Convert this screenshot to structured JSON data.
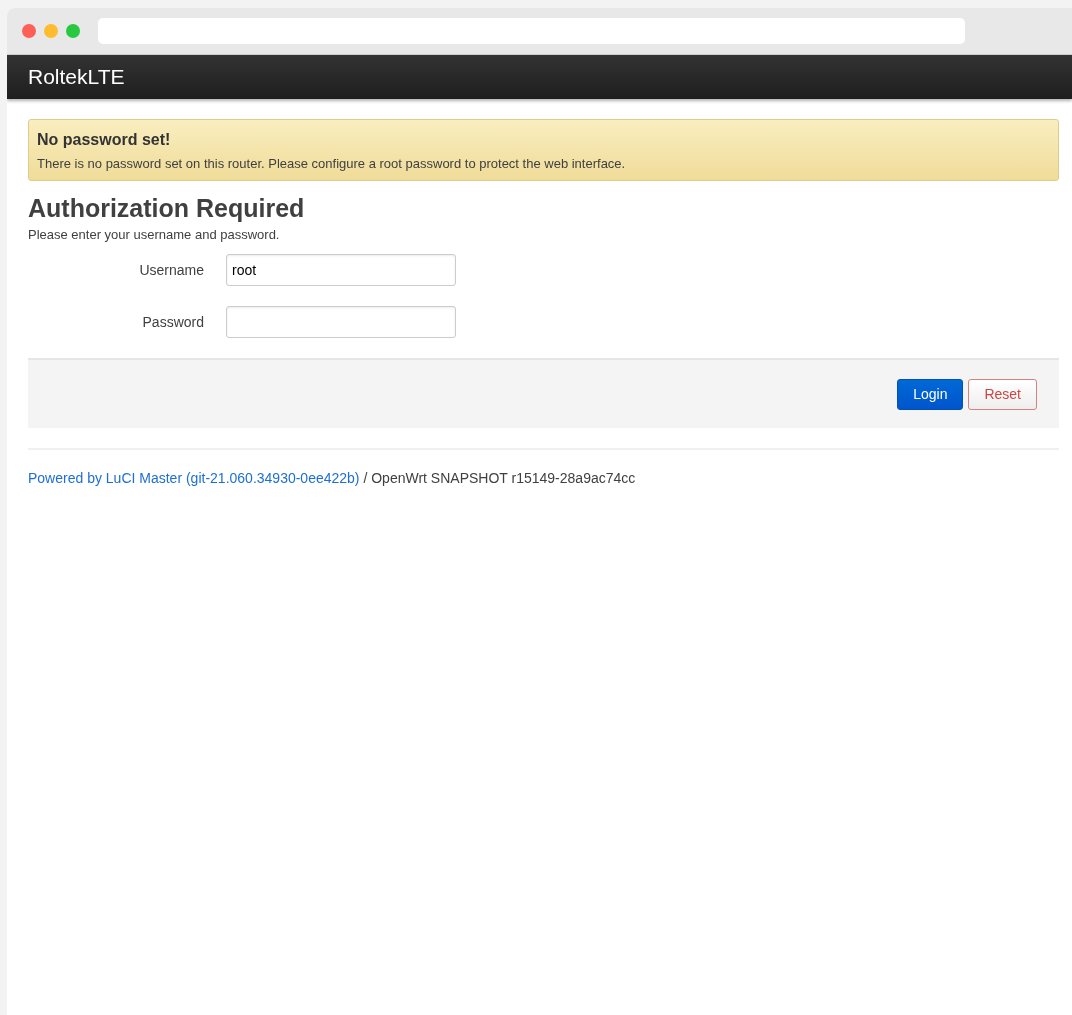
{
  "browser": {
    "traffic_lights": [
      {
        "color": "#fe5f57"
      },
      {
        "color": "#febc2e"
      },
      {
        "color": "#28c840"
      }
    ]
  },
  "header": {
    "brand": "RoltekLTE"
  },
  "alert": {
    "title": "No password set!",
    "message": "There is no password set on this router. Please configure a root password to protect the web interface."
  },
  "login": {
    "title": "Authorization Required",
    "description": "Please enter your username and password.",
    "fields": [
      {
        "label": "Username",
        "value": "root",
        "kind": "text"
      },
      {
        "label": "Password",
        "kind": "password"
      }
    ],
    "buttons": [
      {
        "label": "Login",
        "kind": "primary"
      },
      {
        "label": "Reset",
        "kind": "reset"
      }
    ]
  },
  "footer": {
    "link": "Powered by LuCI Master (git-21.060.34930-0ee422b)",
    "text": " / OpenWrt SNAPSHOT r15149-28a9ac74cc"
  }
}
